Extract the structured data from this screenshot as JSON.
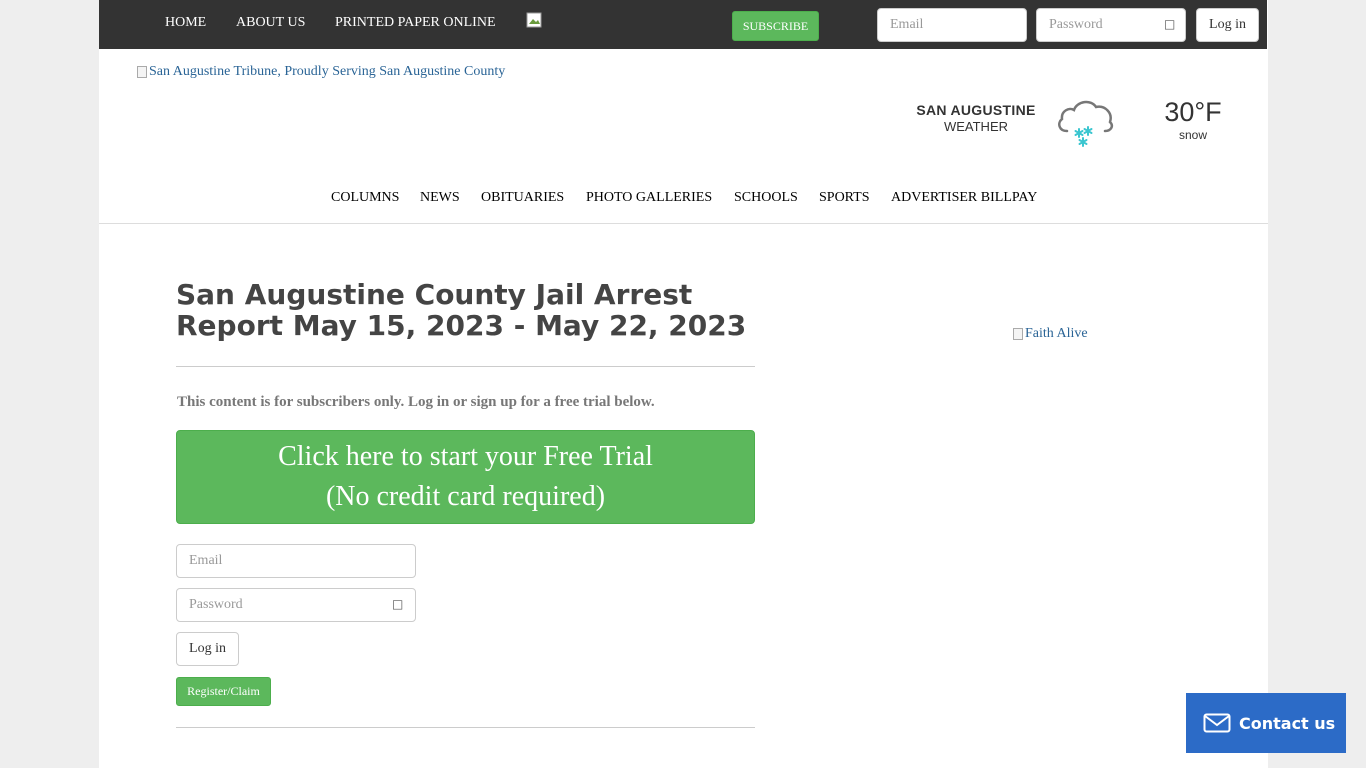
{
  "topbar": {
    "nav": [
      {
        "label": "HOME"
      },
      {
        "label": "ABOUT US"
      },
      {
        "label": "PRINTED PAPER ONLINE"
      }
    ],
    "subscribe_label": "SUBSCRIBE",
    "email_placeholder": "Email",
    "password_placeholder": "Password",
    "login_label": "Log in"
  },
  "header": {
    "logo_alt": "San Augustine Tribune, Proudly Serving San Augustine County",
    "weather": {
      "location": "SAN AUGUSTINE",
      "label": "WEATHER",
      "temperature": "30°F",
      "condition": "snow",
      "icon": "snow-cloud-icon"
    }
  },
  "main_nav": [
    {
      "label": "COLUMNS"
    },
    {
      "label": "NEWS"
    },
    {
      "label": "OBITUARIES"
    },
    {
      "label": "PHOTO GALLERIES"
    },
    {
      "label": "SCHOOLS"
    },
    {
      "label": "SPORTS"
    },
    {
      "label": "ADVERTISER BILLPAY"
    }
  ],
  "article": {
    "title": "San Augustine County Jail Arrest Report May 15, 2023 - May 22, 2023",
    "subscriber_message": "This content is for subscribers only. Log in or sign up for a free trial below.",
    "trial_line1": "Click here to start your Free Trial",
    "trial_line2": "(No credit card required)",
    "email_placeholder": "Email",
    "password_placeholder": "Password",
    "login_label": "Log in",
    "register_label": "Register/Claim"
  },
  "sidebar": {
    "ad_alt": "Faith Alive"
  },
  "contact_widget": {
    "label": "Contact us",
    "icon": "envelope-icon",
    "color": "#2c6bc7"
  },
  "colors": {
    "accent_green": "#5cb85c",
    "topbar": "#333333"
  }
}
